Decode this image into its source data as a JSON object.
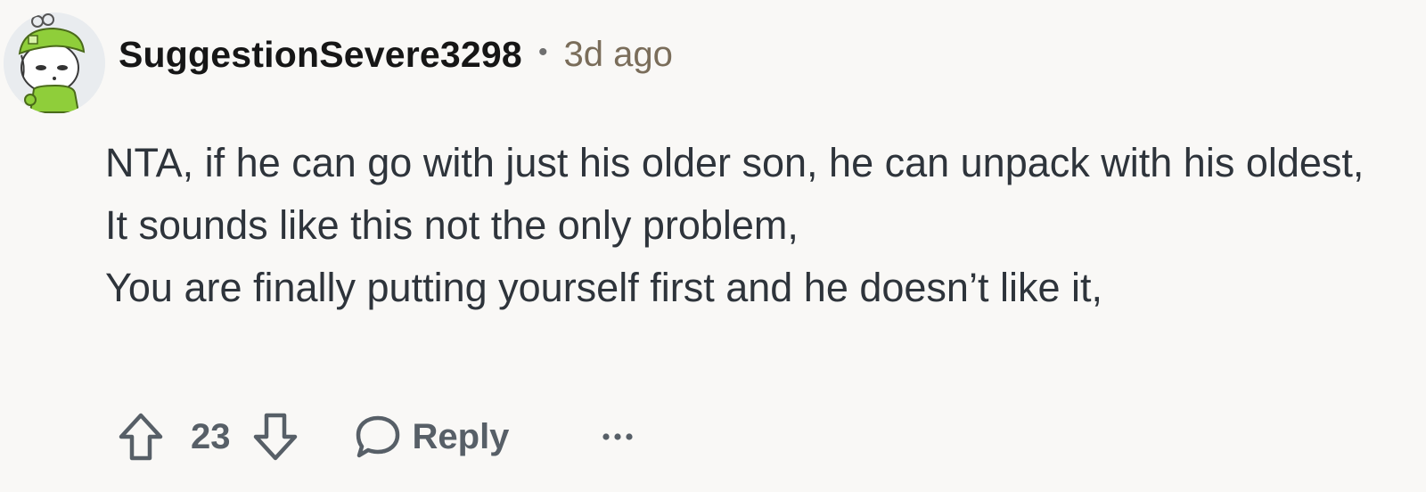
{
  "comment": {
    "author": "SuggestionSevere3298",
    "separator": "•",
    "timestamp": "3d ago",
    "body": [
      "NTA, if he can go with just his older son, he can unpack with his oldest,",
      "It sounds like this not the only problem,",
      "You are finally putting yourself first and he doesn’t like it,"
    ],
    "avatar_icon": "snoo-avatar-green-hat-icon",
    "score": "23",
    "reply_label": "Reply",
    "upvote_icon": "upvote-arrow-icon",
    "downvote_icon": "downvote-arrow-icon",
    "reply_icon": "speech-bubble-icon",
    "more_icon": "ellipsis-icon"
  },
  "colors": {
    "background": "#f9f8f6",
    "username": "#161616",
    "timestamp": "#7a6d5a",
    "body_text": "#2e343b",
    "action_gray": "#575f67",
    "avatar_hat": "#8fce3a"
  }
}
